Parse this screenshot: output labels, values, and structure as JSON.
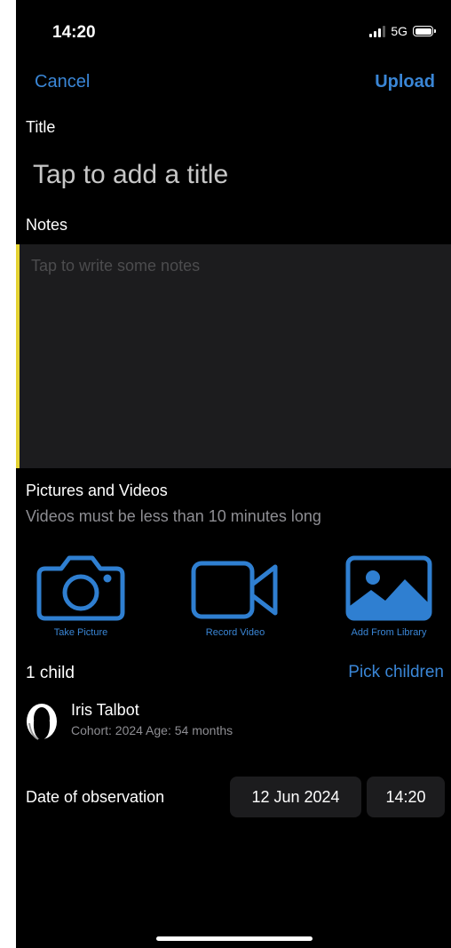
{
  "status_bar": {
    "time": "14:20",
    "network": "5G",
    "signal_icon": "cellular-signal-icon",
    "battery_icon": "battery-icon"
  },
  "nav": {
    "cancel_label": "Cancel",
    "upload_label": "Upload"
  },
  "title_section": {
    "label": "Title",
    "placeholder": "Tap to add a title"
  },
  "notes_section": {
    "label": "Notes",
    "placeholder": "Tap to write some notes"
  },
  "media_section": {
    "label": "Pictures and Videos",
    "subtitle": "Videos must be less than 10 minutes long",
    "buttons": [
      {
        "label": "Take Picture",
        "icon": "camera-icon"
      },
      {
        "label": "Record Video",
        "icon": "video-camera-icon"
      },
      {
        "label": "Add From Library",
        "icon": "photo-library-icon"
      }
    ]
  },
  "children_section": {
    "count_label": "1 child",
    "pick_label": "Pick children",
    "children": [
      {
        "name": "Iris Talbot",
        "meta": "Cohort: 2024 Age: 54 months",
        "icon": "avatar-icon"
      }
    ]
  },
  "date_section": {
    "label": "Date of observation",
    "date": "12 Jun 2024",
    "time": "14:20"
  },
  "colors": {
    "accent": "#3a86d6",
    "background": "#000000",
    "field_background": "#1c1c1e",
    "notes_highlight": "#e4d232",
    "secondary_text": "#8e8e93"
  }
}
